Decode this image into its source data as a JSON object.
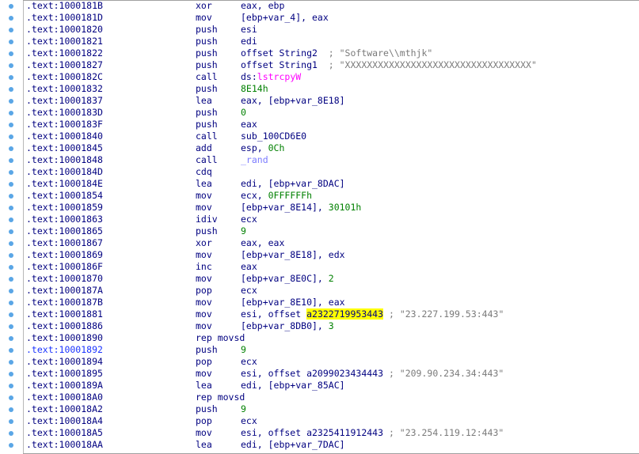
{
  "listing": [
    {
      "addr": ".text:1000181B",
      "mnem": "xor",
      "parts": [
        {
          "t": "eax, ebp",
          "c": "n"
        }
      ]
    },
    {
      "addr": ".text:1000181D",
      "mnem": "mov",
      "parts": [
        {
          "t": "[ebp+var_4], eax",
          "c": "n"
        }
      ]
    },
    {
      "addr": ".text:10001820",
      "mnem": "push",
      "parts": [
        {
          "t": "esi",
          "c": "n"
        }
      ]
    },
    {
      "addr": ".text:10001821",
      "mnem": "push",
      "parts": [
        {
          "t": "edi",
          "c": "n"
        }
      ]
    },
    {
      "addr": ".text:10001822",
      "mnem": "push",
      "parts": [
        {
          "t": "offset String2  ",
          "c": "n"
        },
        {
          "t": "; \"Software\\\\mthjk\"",
          "c": "cmt"
        }
      ]
    },
    {
      "addr": ".text:10001827",
      "mnem": "push",
      "parts": [
        {
          "t": "offset String1  ",
          "c": "n"
        },
        {
          "t": "; \"XXXXXXXXXXXXXXXXXXXXXXXXXXXXXXXXXX\"",
          "c": "cmt"
        }
      ]
    },
    {
      "addr": ".text:1000182C",
      "mnem": "call",
      "parts": [
        {
          "t": "ds:",
          "c": "n"
        },
        {
          "t": "lstrcpyW",
          "c": "imp"
        }
      ]
    },
    {
      "addr": ".text:10001832",
      "mnem": "push",
      "parts": [
        {
          "t": "8E14h",
          "c": "num"
        }
      ]
    },
    {
      "addr": ".text:10001837",
      "mnem": "lea",
      "parts": [
        {
          "t": "eax, [ebp+var_8E18]",
          "c": "n"
        }
      ]
    },
    {
      "addr": ".text:1000183D",
      "mnem": "push",
      "parts": [
        {
          "t": "0",
          "c": "num"
        }
      ]
    },
    {
      "addr": ".text:1000183F",
      "mnem": "push",
      "parts": [
        {
          "t": "eax",
          "c": "n"
        }
      ]
    },
    {
      "addr": ".text:10001840",
      "mnem": "call",
      "parts": [
        {
          "t": "sub_100CD6E0",
          "c": "n"
        }
      ]
    },
    {
      "addr": ".text:10001845",
      "mnem": "add",
      "parts": [
        {
          "t": "esp, ",
          "c": "n"
        },
        {
          "t": "0Ch",
          "c": "num"
        }
      ]
    },
    {
      "addr": ".text:10001848",
      "mnem": "call",
      "parts": [
        {
          "t": "_rand",
          "c": "fn"
        }
      ]
    },
    {
      "addr": ".text:1000184D",
      "mnem": "cdq",
      "parts": []
    },
    {
      "addr": ".text:1000184E",
      "mnem": "lea",
      "parts": [
        {
          "t": "edi, [ebp+var_8DAC]",
          "c": "n"
        }
      ]
    },
    {
      "addr": ".text:10001854",
      "mnem": "mov",
      "parts": [
        {
          "t": "ecx, ",
          "c": "n"
        },
        {
          "t": "0FFFFFFh",
          "c": "num"
        }
      ]
    },
    {
      "addr": ".text:10001859",
      "mnem": "mov",
      "parts": [
        {
          "t": "[ebp+var_8E14], ",
          "c": "n"
        },
        {
          "t": "30101h",
          "c": "num"
        }
      ]
    },
    {
      "addr": ".text:10001863",
      "mnem": "idiv",
      "parts": [
        {
          "t": "ecx",
          "c": "n"
        }
      ]
    },
    {
      "addr": ".text:10001865",
      "mnem": "push",
      "parts": [
        {
          "t": "9",
          "c": "num"
        }
      ]
    },
    {
      "addr": ".text:10001867",
      "mnem": "xor",
      "parts": [
        {
          "t": "eax, eax",
          "c": "n"
        }
      ]
    },
    {
      "addr": ".text:10001869",
      "mnem": "mov",
      "parts": [
        {
          "t": "[ebp+var_8E18], edx",
          "c": "n"
        }
      ]
    },
    {
      "addr": ".text:1000186F",
      "mnem": "inc",
      "parts": [
        {
          "t": "eax",
          "c": "n"
        }
      ]
    },
    {
      "addr": ".text:10001870",
      "mnem": "mov",
      "parts": [
        {
          "t": "[ebp+var_8E0C], ",
          "c": "n"
        },
        {
          "t": "2",
          "c": "num"
        }
      ]
    },
    {
      "addr": ".text:1000187A",
      "mnem": "pop",
      "parts": [
        {
          "t": "ecx",
          "c": "n"
        }
      ]
    },
    {
      "addr": ".text:1000187B",
      "mnem": "mov",
      "parts": [
        {
          "t": "[ebp+var_8E10], eax",
          "c": "n"
        }
      ]
    },
    {
      "addr": ".text:10001881",
      "mnem": "mov",
      "parts": [
        {
          "t": "esi, offset ",
          "c": "n"
        },
        {
          "t": "a2322719953443",
          "c": "hl"
        },
        {
          "t": " ",
          "c": "n"
        },
        {
          "t": "; \"23.227.199.53:443\"",
          "c": "cmt"
        }
      ]
    },
    {
      "addr": ".text:10001886",
      "mnem": "mov",
      "parts": [
        {
          "t": "[ebp+var_8DB0], ",
          "c": "n"
        },
        {
          "t": "3",
          "c": "num"
        }
      ]
    },
    {
      "addr": ".text:10001890",
      "mnem": "rep movsd",
      "parts": []
    },
    {
      "addr": ".text:10001892",
      "mnem": "push",
      "parts": [
        {
          "t": "9",
          "c": "num"
        }
      ],
      "addr_color": "blue"
    },
    {
      "addr": ".text:10001894",
      "mnem": "pop",
      "parts": [
        {
          "t": "ecx",
          "c": "n"
        }
      ]
    },
    {
      "addr": ".text:10001895",
      "mnem": "mov",
      "parts": [
        {
          "t": "esi, offset a2099023434443 ",
          "c": "n"
        },
        {
          "t": "; \"209.90.234.34:443\"",
          "c": "cmt"
        }
      ]
    },
    {
      "addr": ".text:1000189A",
      "mnem": "lea",
      "parts": [
        {
          "t": "edi, [ebp+var_85AC]",
          "c": "n"
        }
      ]
    },
    {
      "addr": ".text:100018A0",
      "mnem": "rep movsd",
      "parts": []
    },
    {
      "addr": ".text:100018A2",
      "mnem": "push",
      "parts": [
        {
          "t": "9",
          "c": "num"
        }
      ]
    },
    {
      "addr": ".text:100018A4",
      "mnem": "pop",
      "parts": [
        {
          "t": "ecx",
          "c": "n"
        }
      ]
    },
    {
      "addr": ".text:100018A5",
      "mnem": "mov",
      "parts": [
        {
          "t": "esi, offset a2325411912443 ",
          "c": "n"
        },
        {
          "t": "; \"23.254.119.12:443\"",
          "c": "cmt"
        }
      ]
    },
    {
      "addr": ".text:100018AA",
      "mnem": "lea",
      "parts": [
        {
          "t": "edi, [ebp+var_7DAC]",
          "c": "n"
        }
      ]
    }
  ],
  "colors": {
    "address": "#000080",
    "address_selected": "#1a33ff",
    "number": "#008000",
    "import": "#ff00ff",
    "function": "#7b7bff",
    "comment": "#7a7a7a",
    "highlight": "#ffff00",
    "breakpoint_dot": "#5aa6e6"
  }
}
